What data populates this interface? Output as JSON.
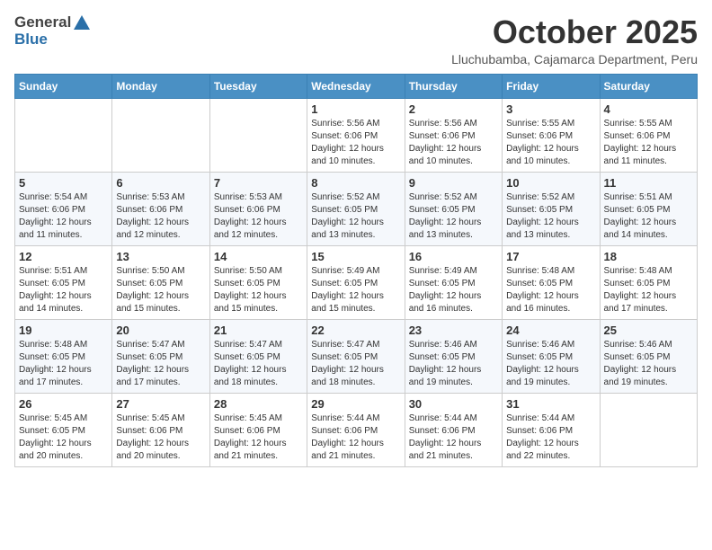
{
  "header": {
    "logo_general": "General",
    "logo_blue": "Blue",
    "month": "October 2025",
    "location": "Lluchubamba, Cajamarca Department, Peru"
  },
  "weekdays": [
    "Sunday",
    "Monday",
    "Tuesday",
    "Wednesday",
    "Thursday",
    "Friday",
    "Saturday"
  ],
  "weeks": [
    [
      {
        "day": "",
        "info": ""
      },
      {
        "day": "",
        "info": ""
      },
      {
        "day": "",
        "info": ""
      },
      {
        "day": "1",
        "info": "Sunrise: 5:56 AM\nSunset: 6:06 PM\nDaylight: 12 hours\nand 10 minutes."
      },
      {
        "day": "2",
        "info": "Sunrise: 5:56 AM\nSunset: 6:06 PM\nDaylight: 12 hours\nand 10 minutes."
      },
      {
        "day": "3",
        "info": "Sunrise: 5:55 AM\nSunset: 6:06 PM\nDaylight: 12 hours\nand 10 minutes."
      },
      {
        "day": "4",
        "info": "Sunrise: 5:55 AM\nSunset: 6:06 PM\nDaylight: 12 hours\nand 11 minutes."
      }
    ],
    [
      {
        "day": "5",
        "info": "Sunrise: 5:54 AM\nSunset: 6:06 PM\nDaylight: 12 hours\nand 11 minutes."
      },
      {
        "day": "6",
        "info": "Sunrise: 5:53 AM\nSunset: 6:06 PM\nDaylight: 12 hours\nand 12 minutes."
      },
      {
        "day": "7",
        "info": "Sunrise: 5:53 AM\nSunset: 6:06 PM\nDaylight: 12 hours\nand 12 minutes."
      },
      {
        "day": "8",
        "info": "Sunrise: 5:52 AM\nSunset: 6:05 PM\nDaylight: 12 hours\nand 13 minutes."
      },
      {
        "day": "9",
        "info": "Sunrise: 5:52 AM\nSunset: 6:05 PM\nDaylight: 12 hours\nand 13 minutes."
      },
      {
        "day": "10",
        "info": "Sunrise: 5:52 AM\nSunset: 6:05 PM\nDaylight: 12 hours\nand 13 minutes."
      },
      {
        "day": "11",
        "info": "Sunrise: 5:51 AM\nSunset: 6:05 PM\nDaylight: 12 hours\nand 14 minutes."
      }
    ],
    [
      {
        "day": "12",
        "info": "Sunrise: 5:51 AM\nSunset: 6:05 PM\nDaylight: 12 hours\nand 14 minutes."
      },
      {
        "day": "13",
        "info": "Sunrise: 5:50 AM\nSunset: 6:05 PM\nDaylight: 12 hours\nand 15 minutes."
      },
      {
        "day": "14",
        "info": "Sunrise: 5:50 AM\nSunset: 6:05 PM\nDaylight: 12 hours\nand 15 minutes."
      },
      {
        "day": "15",
        "info": "Sunrise: 5:49 AM\nSunset: 6:05 PM\nDaylight: 12 hours\nand 15 minutes."
      },
      {
        "day": "16",
        "info": "Sunrise: 5:49 AM\nSunset: 6:05 PM\nDaylight: 12 hours\nand 16 minutes."
      },
      {
        "day": "17",
        "info": "Sunrise: 5:48 AM\nSunset: 6:05 PM\nDaylight: 12 hours\nand 16 minutes."
      },
      {
        "day": "18",
        "info": "Sunrise: 5:48 AM\nSunset: 6:05 PM\nDaylight: 12 hours\nand 17 minutes."
      }
    ],
    [
      {
        "day": "19",
        "info": "Sunrise: 5:48 AM\nSunset: 6:05 PM\nDaylight: 12 hours\nand 17 minutes."
      },
      {
        "day": "20",
        "info": "Sunrise: 5:47 AM\nSunset: 6:05 PM\nDaylight: 12 hours\nand 17 minutes."
      },
      {
        "day": "21",
        "info": "Sunrise: 5:47 AM\nSunset: 6:05 PM\nDaylight: 12 hours\nand 18 minutes."
      },
      {
        "day": "22",
        "info": "Sunrise: 5:47 AM\nSunset: 6:05 PM\nDaylight: 12 hours\nand 18 minutes."
      },
      {
        "day": "23",
        "info": "Sunrise: 5:46 AM\nSunset: 6:05 PM\nDaylight: 12 hours\nand 19 minutes."
      },
      {
        "day": "24",
        "info": "Sunrise: 5:46 AM\nSunset: 6:05 PM\nDaylight: 12 hours\nand 19 minutes."
      },
      {
        "day": "25",
        "info": "Sunrise: 5:46 AM\nSunset: 6:05 PM\nDaylight: 12 hours\nand 19 minutes."
      }
    ],
    [
      {
        "day": "26",
        "info": "Sunrise: 5:45 AM\nSunset: 6:05 PM\nDaylight: 12 hours\nand 20 minutes."
      },
      {
        "day": "27",
        "info": "Sunrise: 5:45 AM\nSunset: 6:06 PM\nDaylight: 12 hours\nand 20 minutes."
      },
      {
        "day": "28",
        "info": "Sunrise: 5:45 AM\nSunset: 6:06 PM\nDaylight: 12 hours\nand 21 minutes."
      },
      {
        "day": "29",
        "info": "Sunrise: 5:44 AM\nSunset: 6:06 PM\nDaylight: 12 hours\nand 21 minutes."
      },
      {
        "day": "30",
        "info": "Sunrise: 5:44 AM\nSunset: 6:06 PM\nDaylight: 12 hours\nand 21 minutes."
      },
      {
        "day": "31",
        "info": "Sunrise: 5:44 AM\nSunset: 6:06 PM\nDaylight: 12 hours\nand 22 minutes."
      },
      {
        "day": "",
        "info": ""
      }
    ]
  ]
}
